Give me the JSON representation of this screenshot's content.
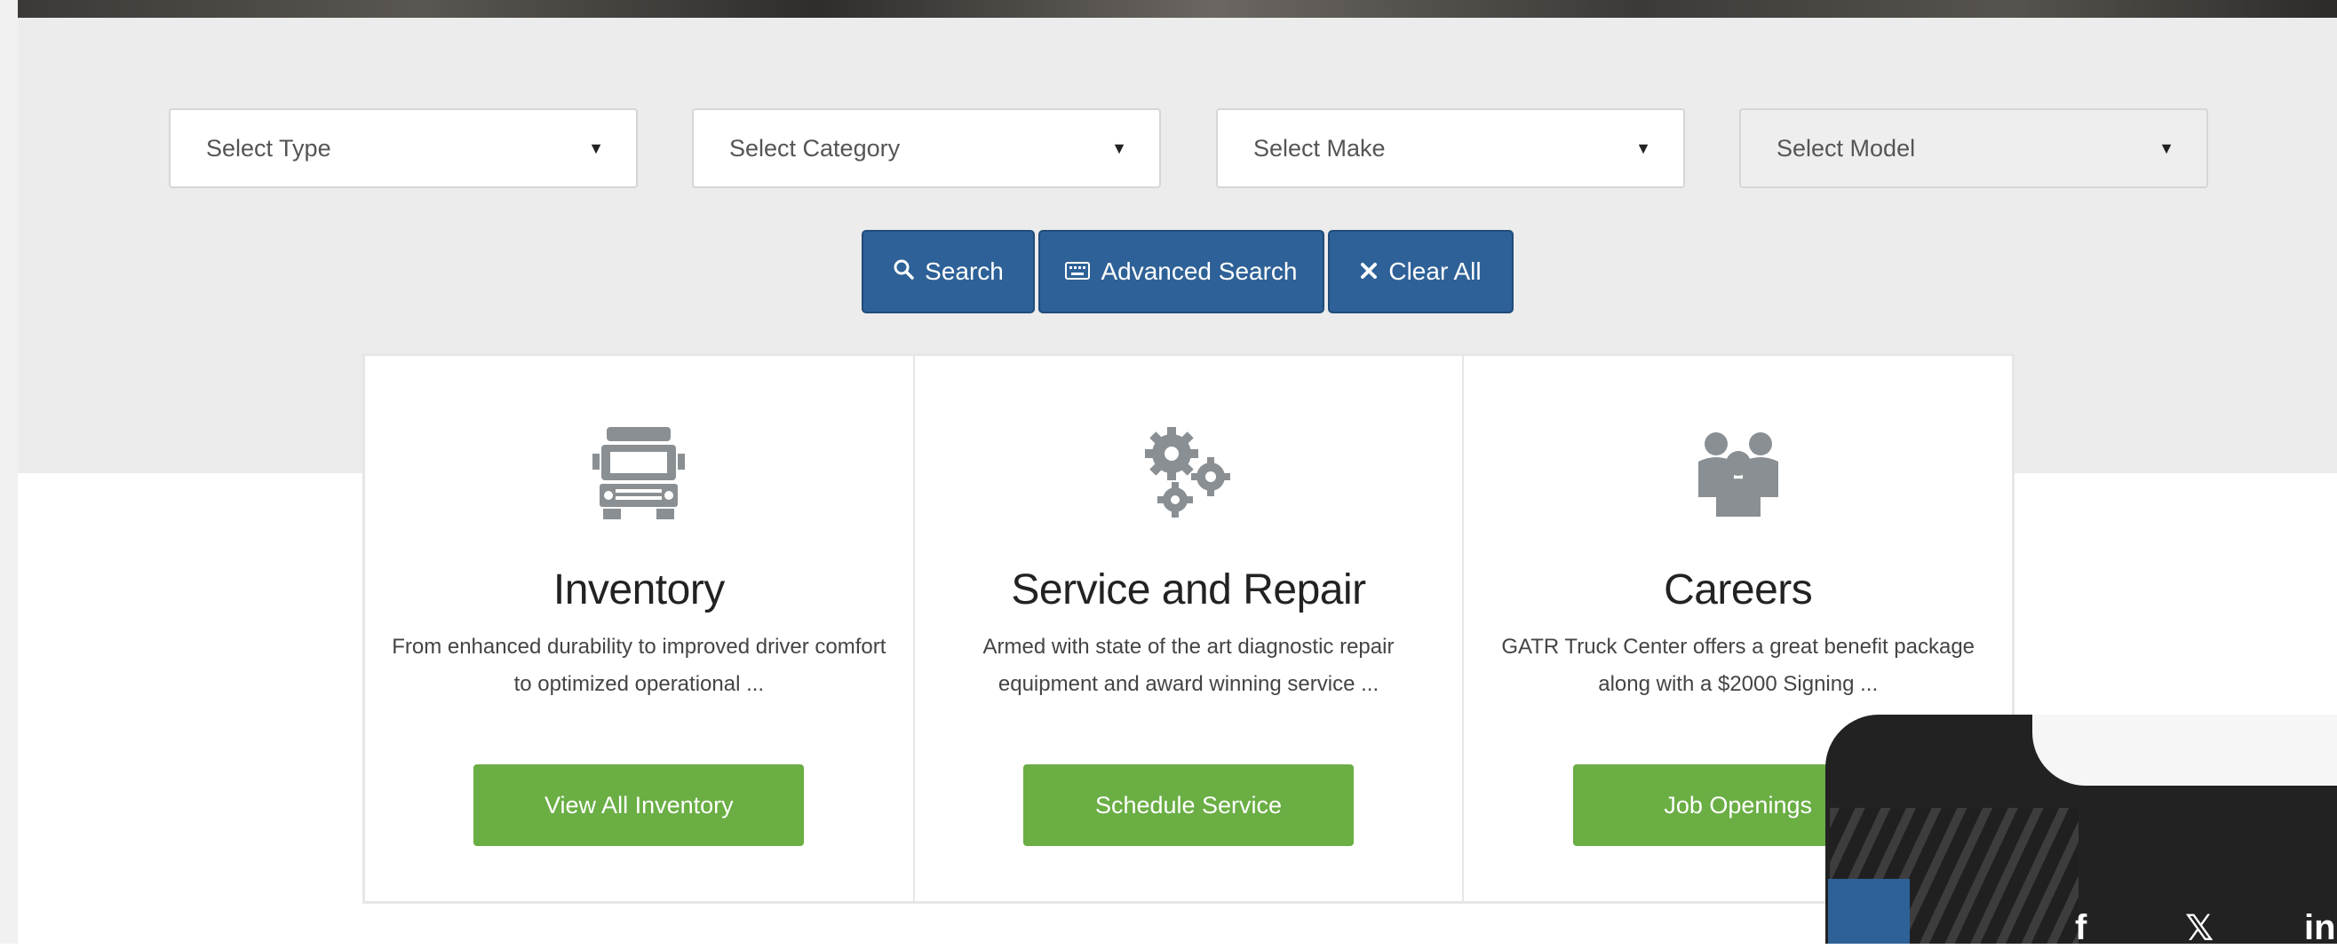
{
  "filters": {
    "type": "Select Type",
    "category": "Select Category",
    "make": "Select Make",
    "model": "Select Model",
    "caret": "▼"
  },
  "buttons": {
    "search": "Search",
    "advanced": "Advanced Search",
    "clear": "Clear All"
  },
  "cards": [
    {
      "icon": "truck-icon",
      "title": "Inventory",
      "text": "From enhanced durability to improved driver comfort to optimized operational ...",
      "button": "View All Inventory"
    },
    {
      "icon": "gears-icon",
      "title": "Service and Repair",
      "text": "Armed with state of the art diagnostic repair equipment and award winning service ...",
      "button": "Schedule Service"
    },
    {
      "icon": "people-icon",
      "title": "Careers",
      "text": "GATR Truck Center offers a great benefit package along with a $2000 Signing ...",
      "button": "Job Openings"
    }
  ],
  "social": {
    "facebook": "f",
    "twitter": "𝕏",
    "linkedin": "in"
  },
  "colors": {
    "primary_blue": "#2e6197",
    "action_green": "#6aae44",
    "icon_gray": "#8a8f93"
  }
}
